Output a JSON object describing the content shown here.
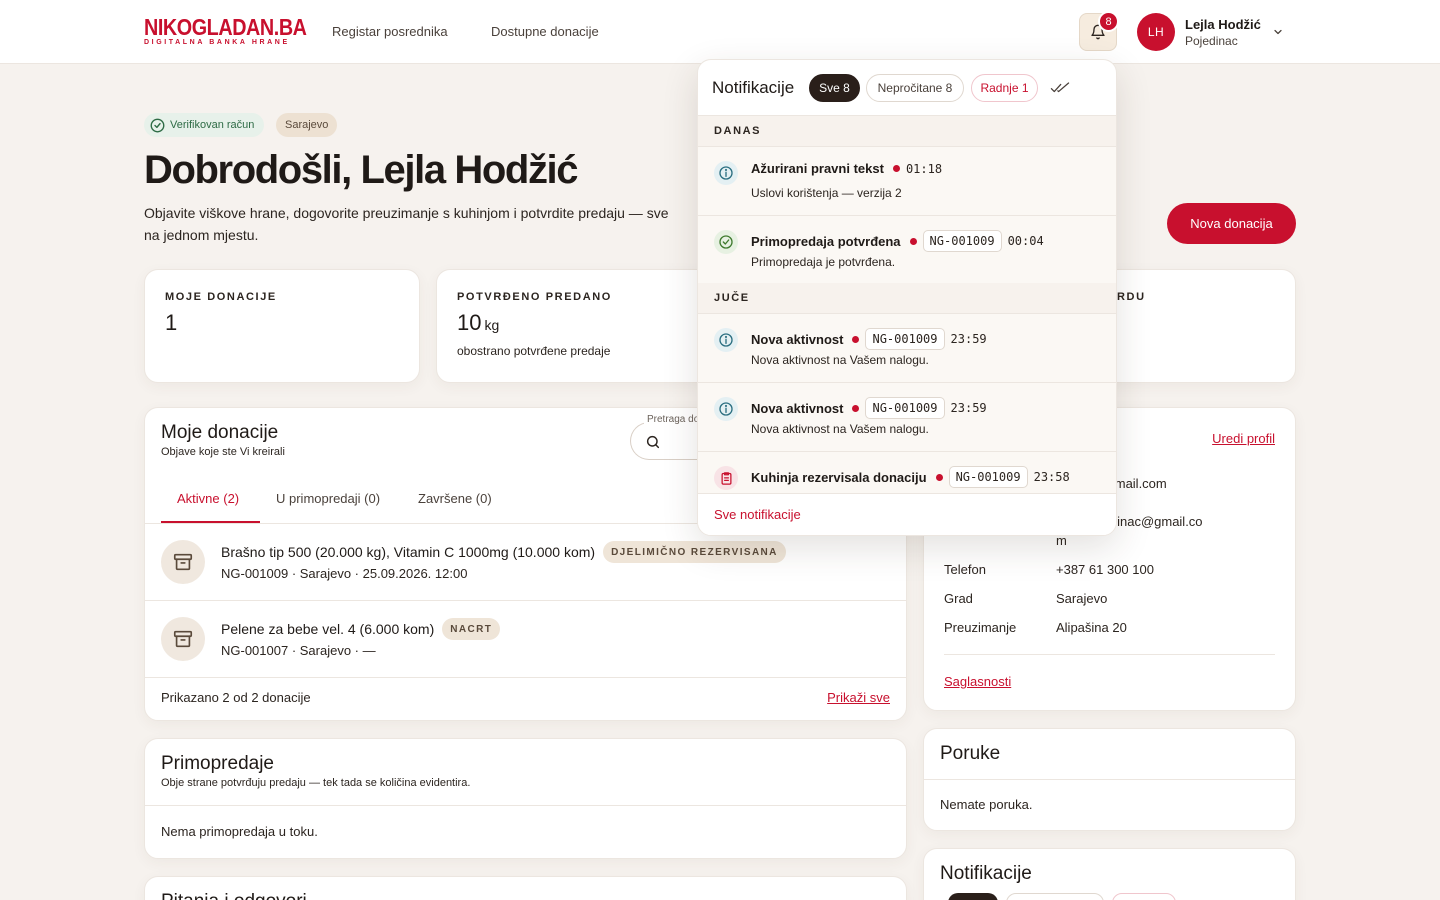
{
  "header": {
    "logo_main": "NIKOGLADAN.BA",
    "logo_sub": "DIGITALNA BANKA HRANE",
    "nav": [
      "Registar posrednika",
      "Dostupne donacije"
    ],
    "notif_count": "8",
    "avatar_initials": "LH",
    "user_name": "Lejla Hodžić",
    "user_role": "Pojedinac"
  },
  "hero": {
    "verified": "Verifikovan račun",
    "city": "Sarajevo",
    "title": "Dobrodošli, Lejla Hodžić",
    "subtitle": "Objavite viškove hrane, dogovorite preuzimanje s kuhinjom i potvrdite predaju — sve na jednom mjestu.",
    "new_button": "Nova donacija"
  },
  "stats": [
    {
      "label": "MOJE DONACIJE",
      "value": "1",
      "unit": "",
      "note": ""
    },
    {
      "label": "POTVRĐENO PREDANO",
      "value": "10",
      "unit": "kg",
      "note": "obostrano potvrđene predaje"
    },
    {
      "label": "RDU",
      "value": "",
      "unit": "",
      "note": ""
    }
  ],
  "donations": {
    "title": "Moje donacije",
    "subtitle": "Objave koje ste Vi kreirali",
    "search_label": "Pretraga do",
    "tabs": [
      "Aktivne (2)",
      "U primopredaji (0)",
      "Završene (0)"
    ],
    "rows": [
      {
        "title": "Brašno tip 500 (20.000 kg), Vitamin C 1000mg (10.000 kom)",
        "badge": "DJELIMIČNO REZERVISANA",
        "meta": "NG-001009 · Sarajevo · 25.09.2026. 12:00"
      },
      {
        "title": "Pelene za bebe vel. 4 (6.000 kom)",
        "badge": "NACRT",
        "meta": "NG-001007 · Sarajevo · —"
      }
    ],
    "footer": "Prikazano 2 od 2 donacije",
    "show_all": "Prikaži sve"
  },
  "handover": {
    "title": "Primopredaje",
    "subtitle": "Obje strane potvrđuju predaju — tek tada se količina evidentira.",
    "empty": "Nema primopredaja u toku."
  },
  "qa": {
    "title": "Pitanja i odgovori"
  },
  "profile": {
    "edit": "Uredi profil",
    "email1": "edinac@gmail.com",
    "email2_line1": "nba+pojedinac@gmail.co",
    "email2_line2": "m",
    "rows": [
      {
        "label": "Telefon",
        "value": "+387 61 300 100"
      },
      {
        "label": "Grad",
        "value": "Sarajevo"
      },
      {
        "label": "Preuzimanje",
        "value": "Alipašina 20"
      }
    ],
    "consents": "Saglasnosti"
  },
  "messages": {
    "title": "Poruke",
    "empty": "Nemate poruka."
  },
  "notif_card": {
    "title": "Notifikacije"
  },
  "notifications": {
    "title": "Notifikacije",
    "chips": [
      "Sve 8",
      "Nepročitane 8",
      "Radnje 1"
    ],
    "sections": [
      "DANAS",
      "JUČE"
    ],
    "items": [
      {
        "title": "Ažurirani pravni tekst",
        "ref": "",
        "time": "01:18",
        "body": "Uslovi korištenja — verzija 2",
        "icon": "info-icon"
      },
      {
        "title": "Primopredaja potvrđena",
        "ref": "NG-001009",
        "time": "00:04",
        "body": "Primopredaja je potvrđena.",
        "icon": "check-circle-icon"
      },
      {
        "title": "Nova aktivnost",
        "ref": "NG-001009",
        "time": "23:59",
        "body": "Nova aktivnost na Vašem nalogu.",
        "icon": "info-icon"
      },
      {
        "title": "Nova aktivnost",
        "ref": "NG-001009",
        "time": "23:59",
        "body": "Nova aktivnost na Vašem nalogu.",
        "icon": "info-icon"
      },
      {
        "title": "Kuhinja rezervisala donaciju",
        "ref": "NG-001009",
        "time": "23:58",
        "body": "",
        "icon": "clipboard-icon"
      }
    ],
    "footer": "Sve notifikacije"
  },
  "colors": {
    "accent": "#c8102e",
    "background": "#f6f2ee",
    "dark_chip": "#2a1f1a"
  }
}
